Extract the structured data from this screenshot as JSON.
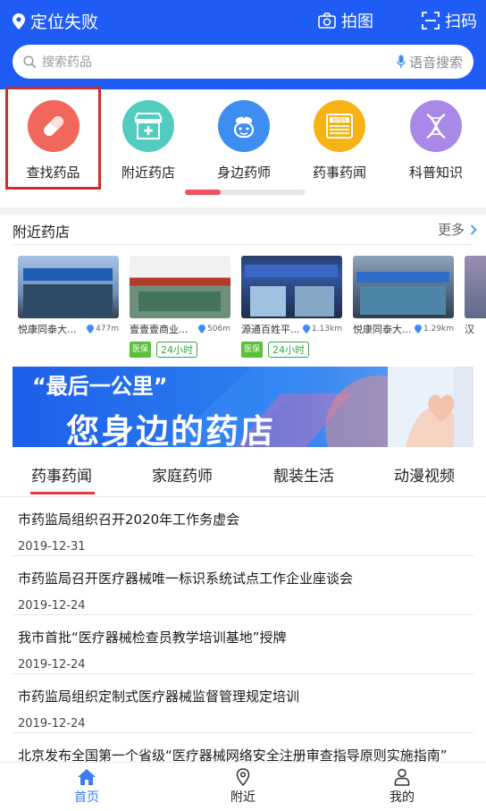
{
  "header": {
    "location_label": "定位失败",
    "photo_label": "拍图",
    "scan_label": "扫码",
    "search_placeholder": "搜索药品",
    "voice_label": "语音搜索",
    "brand_color": "#1f5cf5"
  },
  "categories": [
    {
      "label": "查找药品",
      "icon": "pill-icon",
      "color": "#f2675c"
    },
    {
      "label": "附近药店",
      "icon": "pharmacy-store-icon",
      "color": "#53ccc0"
    },
    {
      "label": "身边药师",
      "icon": "pharmacist-icon",
      "color": "#3d8ef0"
    },
    {
      "label": "药事药闻",
      "icon": "news-icon",
      "color": "#f6b313"
    },
    {
      "label": "科普知识",
      "icon": "dna-icon",
      "color": "#a889e8"
    }
  ],
  "stores_section": {
    "title": "附近药店",
    "more": "更多",
    "stores": [
      {
        "name": "悦康同泰大...",
        "distance": "477m",
        "tags": []
      },
      {
        "name": "壹壹壹商业...",
        "distance": "506m",
        "tags": [
          "医保",
          "24小时"
        ]
      },
      {
        "name": "源通百姓平...",
        "distance": "1.13km",
        "tags": [
          "医保",
          "24小时"
        ]
      },
      {
        "name": "悦康同泰大...",
        "distance": "1.29km",
        "tags": []
      },
      {
        "name": "汉",
        "distance": "",
        "tags": []
      }
    ]
  },
  "banner": {
    "quote": "“最后一公里”",
    "headline": "您身边的药店"
  },
  "news_tabs": [
    "药事药闻",
    "家庭药师",
    "靓装生活",
    "动漫视频"
  ],
  "news": [
    {
      "title": "市药监局组织召开2020年工作务虚会",
      "date": "2019-12-31"
    },
    {
      "title": "市药监局召开医疗器械唯一标识系统试点工作企业座谈会",
      "date": "2019-12-24"
    },
    {
      "title": "我市首批“医疗器械检查员教学培训基地”授牌",
      "date": "2019-12-24"
    },
    {
      "title": "市药监局组织定制式医疗器械监督管理规定培训",
      "date": "2019-12-24"
    },
    {
      "title": "北京发布全国第一个省级“医疗器械网络安全注册审查指导原则实施指南”",
      "date": ""
    }
  ],
  "bottom_nav": [
    {
      "label": "首页",
      "icon": "home-icon"
    },
    {
      "label": "附近",
      "icon": "location-pin-icon"
    },
    {
      "label": "我的",
      "icon": "user-icon"
    }
  ]
}
